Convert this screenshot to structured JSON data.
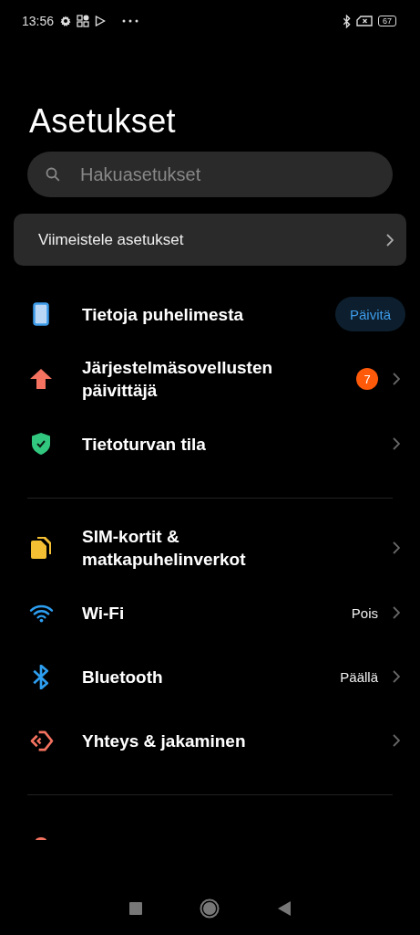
{
  "status_bar": {
    "time": "13:56",
    "battery": "67"
  },
  "title": "Asetukset",
  "search": {
    "placeholder": "Hakuasetukset"
  },
  "setup_card": {
    "label": "Viimeistele asetukset"
  },
  "sections": [
    {
      "items": [
        {
          "kind": "phone",
          "label": "Tietoja puhelimesta",
          "button": "Päivitä",
          "chevron": false
        },
        {
          "kind": "update",
          "label": "Järjestelmäsovellusten päivittäjä",
          "badge": "7",
          "chevron": true
        },
        {
          "kind": "security",
          "label": "Tietoturvan tila",
          "chevron": true
        }
      ]
    },
    {
      "items": [
        {
          "kind": "sim",
          "label": "SIM-kortit & matkapuhelinverkot",
          "chevron": true
        },
        {
          "kind": "wifi",
          "label": "Wi-Fi",
          "value": "Pois",
          "chevron": true
        },
        {
          "kind": "bluetooth",
          "label": "Bluetooth",
          "value": "Päällä",
          "chevron": true
        },
        {
          "kind": "sharing",
          "label": "Yhteys & jakaminen",
          "chevron": true
        }
      ]
    }
  ]
}
